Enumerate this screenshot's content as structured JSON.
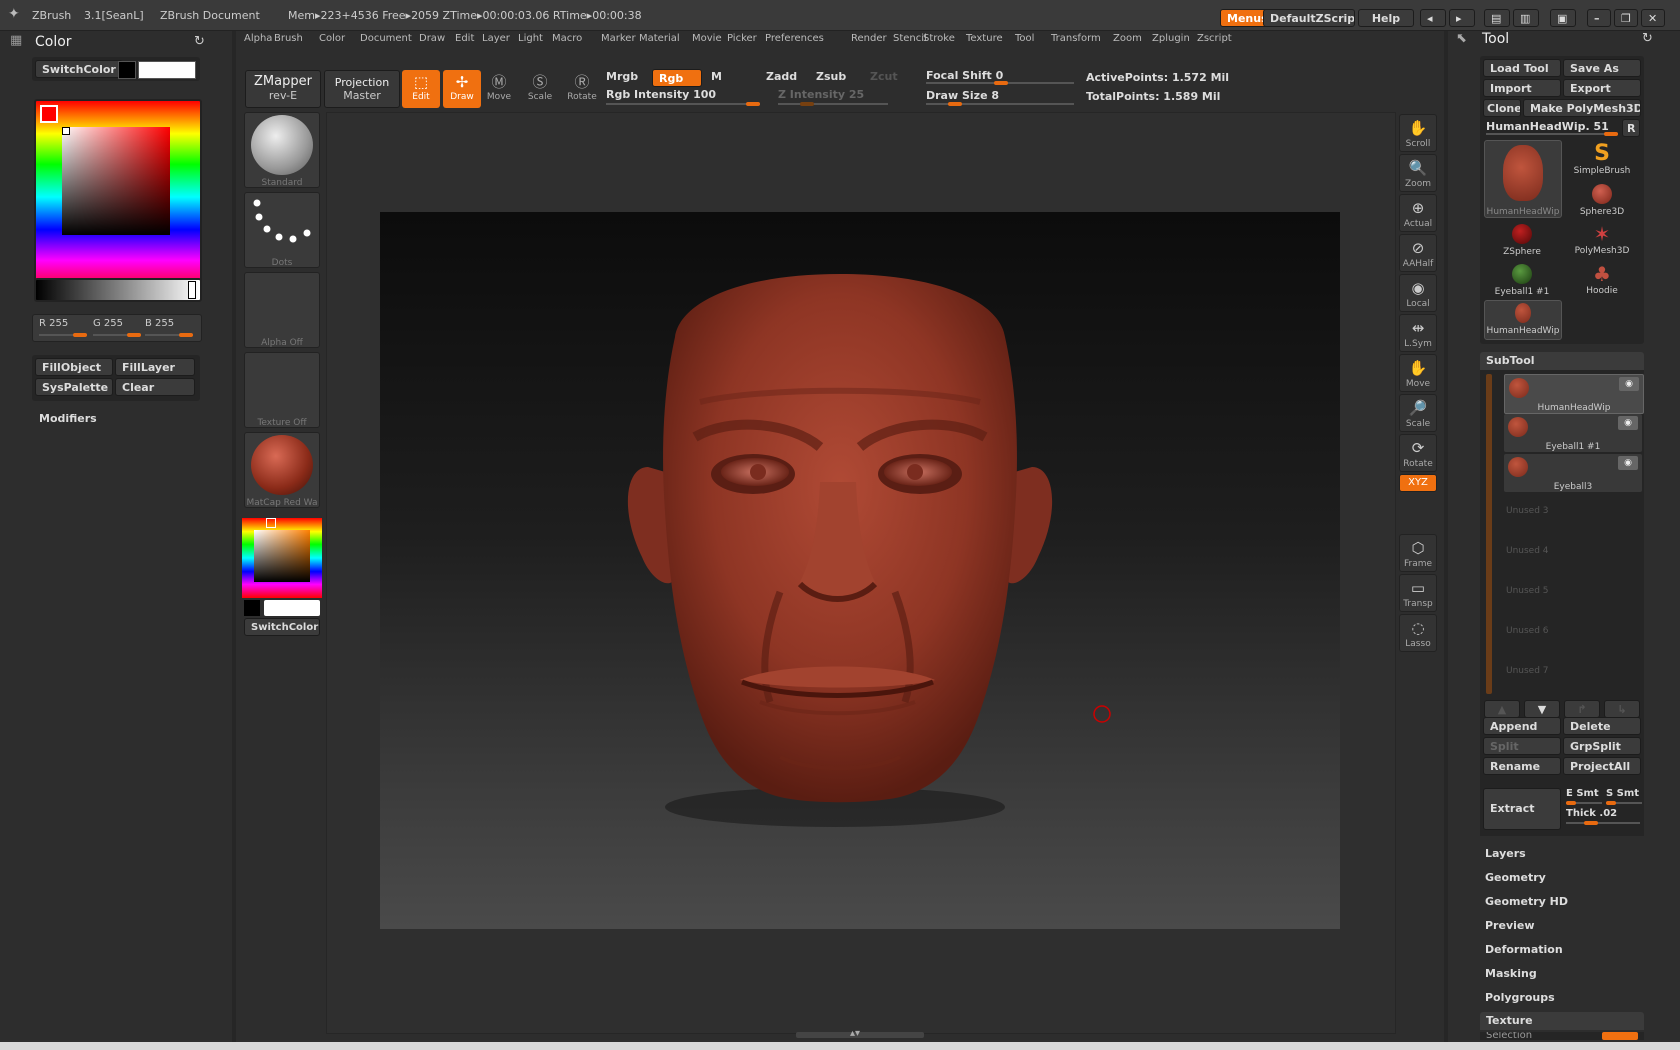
{
  "title_bar": {
    "app": "ZBrush",
    "version": "3.1[SeanL]",
    "document": "ZBrush Document",
    "stats": "Mem▸223+4536  Free▸2059  ZTime▸00:00:03.06  RTime▸00:00:38",
    "menus_btn": "Menus",
    "zscript_btn": "DefaultZScript",
    "help_btn": "Help"
  },
  "menu_bar": [
    "Alpha",
    "Brush",
    "Color",
    "Document",
    "Draw",
    "Edit",
    "Layer",
    "Light",
    "Macro",
    "Marker",
    "Material",
    "Movie",
    "Picker",
    "Preferences",
    "Render",
    "Stencil",
    "Stroke",
    "Texture",
    "Tool",
    "Transform",
    "Zoom",
    "Zplugin",
    "Zscript"
  ],
  "color_panel": {
    "title": "Color",
    "switch_color": "SwitchColor",
    "r": "R 255",
    "g": "G 255",
    "b": "B 255",
    "fill_object": "FillObject",
    "fill_layer": "FillLayer",
    "sys_palette": "SysPalette",
    "clear": "Clear",
    "modifiers": "Modifiers"
  },
  "toolbar": {
    "zmapper": "ZMapper",
    "zmapper_sub": "rev-E",
    "projection": "Projection",
    "projection_sub": "Master",
    "edit": "Edit",
    "draw": "Draw",
    "move": "Move",
    "scale": "Scale",
    "rotate": "Rotate",
    "mrgb": "Mrgb",
    "rgb": "Rgb",
    "m": "M",
    "rgb_intensity": "Rgb Intensity 100",
    "zadd": "Zadd",
    "zsub": "Zsub",
    "zcut": "Zcut",
    "z_intensity": "Z Intensity 25",
    "focal_shift": "Focal Shift 0",
    "draw_size": "Draw Size 8",
    "active_points": "ActivePoints: 1.572 Mil",
    "total_points": "TotalPoints: 1.589 Mil"
  },
  "left_shelf": {
    "standard": "Standard",
    "dots": "Dots",
    "alpha_off": "Alpha Off",
    "texture_off": "Texture Off",
    "matcap": "MatCap Red Wa",
    "switch_color": "SwitchColor"
  },
  "right_shelf": [
    "Scroll",
    "Zoom",
    "Actual",
    "AAHalf",
    "Local",
    "L.Sym",
    "Move",
    "Scale",
    "Rotate",
    "XYZ",
    "Frame",
    "Transp",
    "Lasso"
  ],
  "tool_panel": {
    "title": "Tool",
    "load_tool": "Load Tool",
    "save_as": "Save As",
    "import": "Import",
    "export": "Export",
    "clone": "Clone",
    "make_polymesh": "Make PolyMesh3D",
    "current_tool": "HumanHeadWip. 51",
    "r_btn": "R",
    "tools": [
      "HumanHeadWip",
      "SimpleBrush",
      "Sphere3D",
      "ZSphere",
      "PolyMesh3D",
      "Eyeball1 #1",
      "Hoodie",
      "HumanHeadWip"
    ],
    "subtool_title": "SubTool",
    "subtools": [
      "HumanHeadWip",
      "Eyeball1 #1",
      "Eyeball3"
    ],
    "unused": [
      "Unused 3",
      "Unused 4",
      "Unused 5",
      "Unused 6",
      "Unused 7"
    ],
    "append": "Append",
    "delete": "Delete",
    "split": "Split",
    "grpsplit": "GrpSplit",
    "rename": "Rename",
    "project_all": "ProjectAll",
    "extract": "Extract",
    "e_smt": "E Smt",
    "s_smt": "S Smt",
    "thick": "Thick .02",
    "sections": [
      "Layers",
      "Geometry",
      "Geometry HD",
      "Preview",
      "Deformation",
      "Masking",
      "Polygroups"
    ],
    "texture": "Texture",
    "selection_partial": "Selection"
  },
  "colors": {
    "accent": "#f07010",
    "skin": "#9a3a28",
    "panel": "#2d2d2d"
  }
}
